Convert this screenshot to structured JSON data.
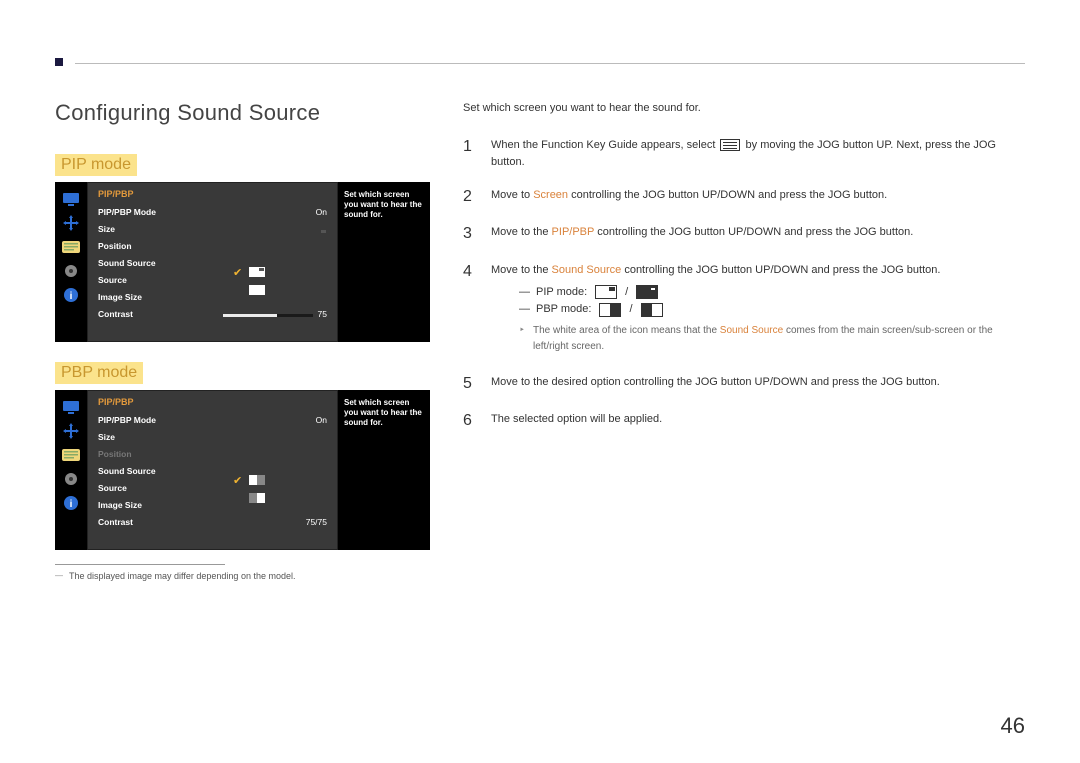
{
  "header": {
    "title": "Configuring Sound Source"
  },
  "left": {
    "pip_label": "PIP mode",
    "pbp_label": "PBP mode",
    "osd_title": "PIP/PBP",
    "osd_desc": "Set which screen you want to hear the sound for.",
    "rows": {
      "mode": "PIP/PBP Mode",
      "mode_val": "On",
      "size": "Size",
      "position": "Position",
      "sound": "Sound Source",
      "source": "Source",
      "imgsize": "Image Size",
      "contrast": "Contrast",
      "contrast_val_pip": "75",
      "contrast_val_pbp": "75/75"
    },
    "footnote": "The displayed image may differ depending on the model."
  },
  "right": {
    "intro": "Set which screen you want to hear the sound for.",
    "steps": {
      "s1a": "When the Function Key Guide appears, select ",
      "s1b": " by moving the JOG button UP. Next, press the JOG button.",
      "s2a": "Move to ",
      "s2_screen": "Screen",
      "s2b": " controlling the JOG button UP/DOWN and press the JOG button.",
      "s3a": "Move to the ",
      "s3_pip": "PIP/PBP",
      "s3b": " controlling the JOG button UP/DOWN and press the JOG button.",
      "s4a": "Move to the ",
      "s4_ss": "Sound Source",
      "s4b": " controlling the JOG button UP/DOWN and press the JOG button.",
      "pip_line": "PIP mode:",
      "pbp_line": "PBP mode:",
      "slash": " / ",
      "note_a": "The white area of the icon means that the ",
      "note_ss": "Sound Source",
      "note_b": " comes from the main screen/sub-screen or the left/right screen.",
      "s5": "Move to the desired option controlling the JOG button UP/DOWN and press the JOG button.",
      "s6": "The selected option will be applied."
    }
  },
  "nums": {
    "n1": "1",
    "n2": "2",
    "n3": "3",
    "n4": "4",
    "n5": "5",
    "n6": "6"
  },
  "bullet": "―",
  "page_number": "46"
}
